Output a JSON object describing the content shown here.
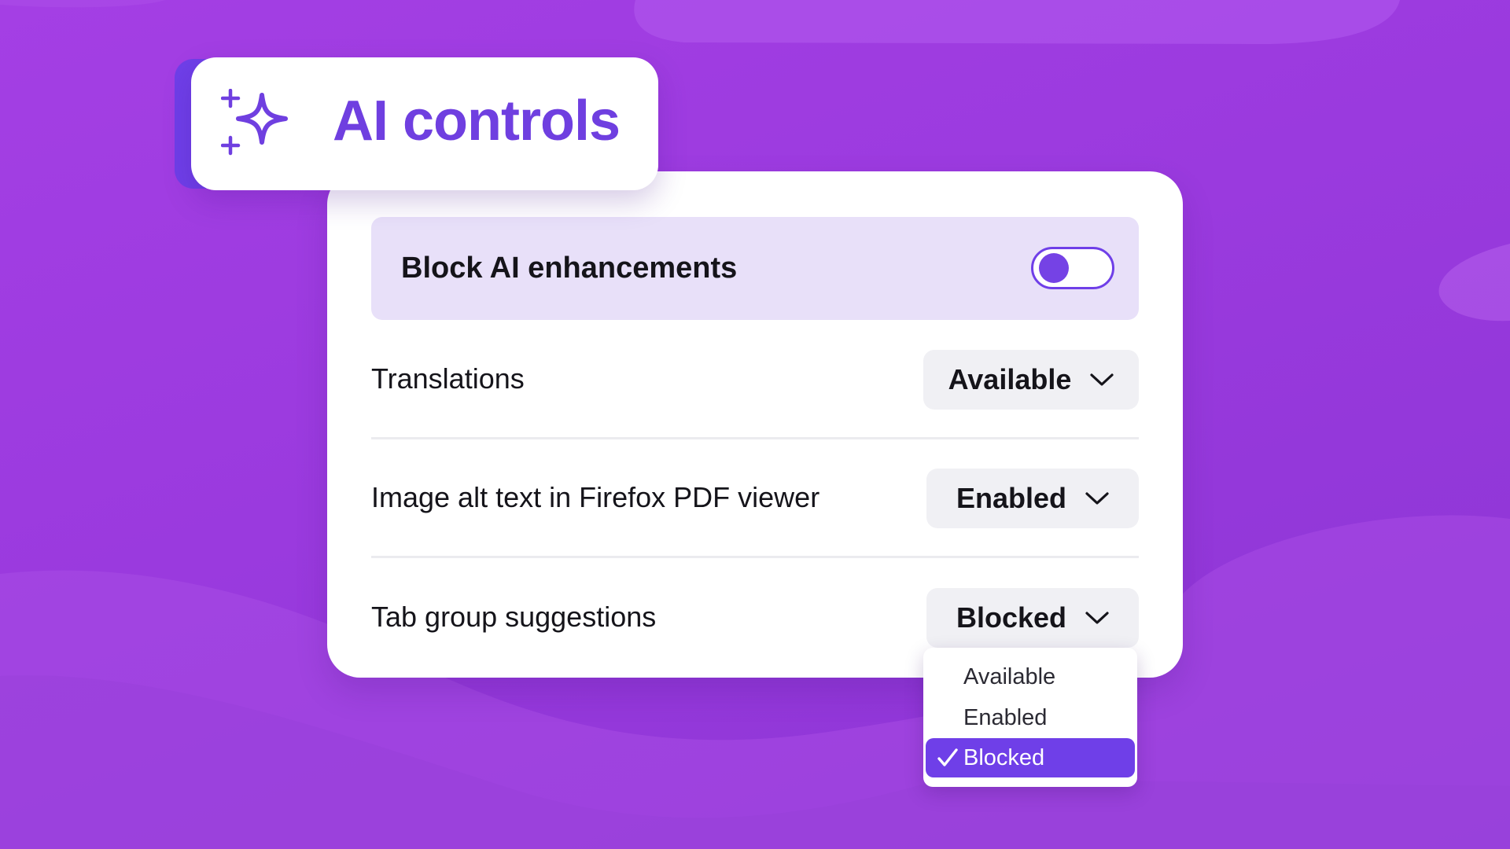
{
  "colors": {
    "accent": "#6f3fe8",
    "toggle_track_bg": "#e8e0f9",
    "background": "#9a3ade"
  },
  "header": {
    "icon": "sparkle-icon",
    "title": "AI controls"
  },
  "block_ai": {
    "label": "Block AI enhancements",
    "toggle_on": false
  },
  "settings": [
    {
      "label": "Translations",
      "value": "Available"
    },
    {
      "label": "Image alt text in Firefox PDF viewer",
      "value": "Enabled"
    },
    {
      "label": "Tab group suggestions",
      "value": "Blocked"
    }
  ],
  "dropdown": {
    "options": [
      "Available",
      "Enabled",
      "Blocked"
    ],
    "selected": "Blocked"
  }
}
